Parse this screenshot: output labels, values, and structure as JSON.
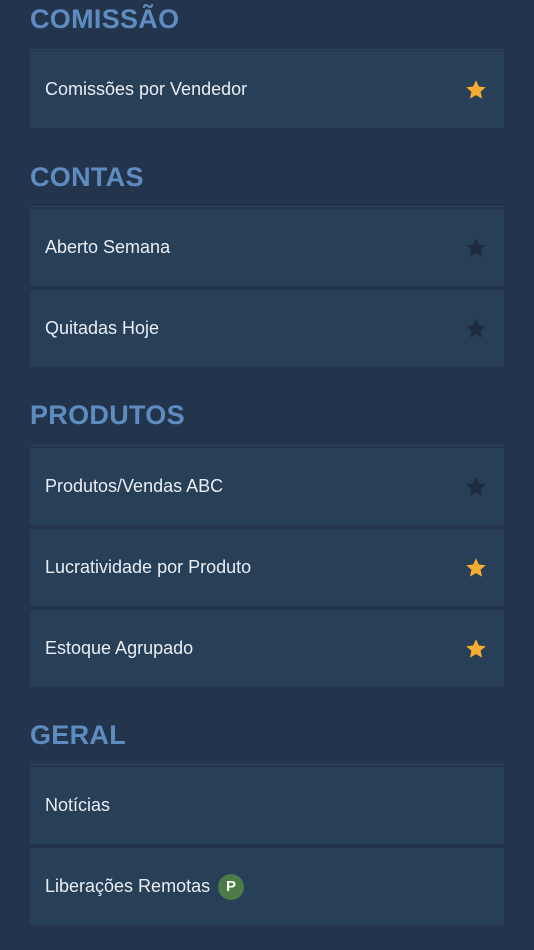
{
  "colors": {
    "background": "#22354d",
    "card": "#283f58",
    "section_title": "#5f8cc0",
    "star_active": "#f6ac2f",
    "star_inactive": "#1c2b3d",
    "badge": "#4c7b47"
  },
  "sections": [
    {
      "title": "COMISSÃO",
      "items": [
        {
          "label": "Comissões por Vendedor",
          "favorite": true,
          "icon": "star-icon"
        }
      ]
    },
    {
      "title": "CONTAS",
      "items": [
        {
          "label": "Aberto Semana",
          "favorite": false,
          "icon": "star-icon"
        },
        {
          "label": "Quitadas Hoje",
          "favorite": false,
          "icon": "star-icon"
        }
      ]
    },
    {
      "title": "PRODUTOS",
      "items": [
        {
          "label": "Produtos/Vendas ABC",
          "favorite": false,
          "icon": "star-icon"
        },
        {
          "label": "Lucratividade por Produto",
          "favorite": true,
          "icon": "star-icon"
        },
        {
          "label": "Estoque Agrupado",
          "favorite": true,
          "icon": "star-icon"
        }
      ]
    },
    {
      "title": "GERAL",
      "items": [
        {
          "label": "Notícias"
        },
        {
          "label": "Liberações Remotas",
          "badge": "P"
        }
      ]
    }
  ]
}
